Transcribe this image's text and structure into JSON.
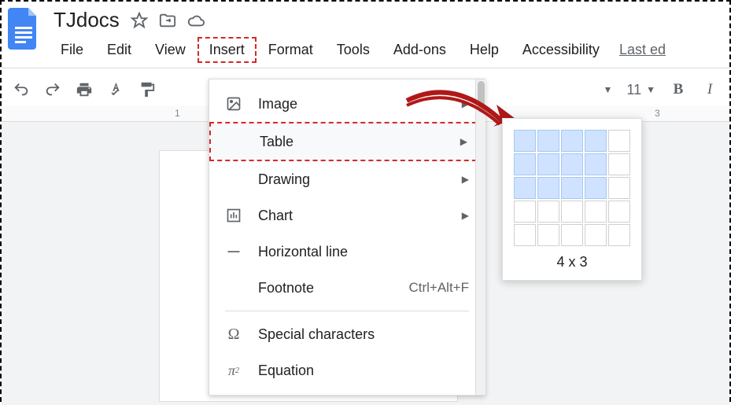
{
  "doc_title": "TJdocs",
  "menubar": {
    "file": "File",
    "edit": "Edit",
    "view": "View",
    "insert": "Insert",
    "format": "Format",
    "tools": "Tools",
    "addons": "Add-ons",
    "help": "Help",
    "accessibility": "Accessibility"
  },
  "last_edit": "Last ed",
  "toolbar": {
    "font_size": "11",
    "bold": "B",
    "italic": "I"
  },
  "ruler": {
    "mark1": "1",
    "mark3": "3"
  },
  "insert_menu": {
    "image": "Image",
    "table": "Table",
    "drawing": "Drawing",
    "chart": "Chart",
    "horizontal_line": "Horizontal line",
    "footnote": "Footnote",
    "footnote_shortcut": "Ctrl+Alt+F",
    "special_chars": "Special characters",
    "equation": "Equation"
  },
  "table_picker": {
    "size_label": "4 x 3",
    "cols": 4,
    "rows": 3
  }
}
